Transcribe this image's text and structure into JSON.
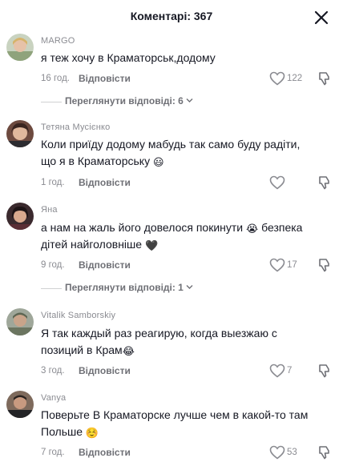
{
  "header": {
    "title": "Коментарі: 367"
  },
  "comments": [
    {
      "author": "MARGO",
      "text": "я теж хочу в Краматорськ,додому",
      "time": "16 год.",
      "reply_label": "Відповісти",
      "likes": "122",
      "view_replies": "Переглянути відповіді: 6"
    },
    {
      "author": "Тетяна Мусієнко",
      "text": "Коли приїду додому мабудь так само буду радіти, що я в Краматорську",
      "emoji": "😃",
      "time": "1 год.",
      "reply_label": "Відповісти",
      "likes": ""
    },
    {
      "author": "Яна",
      "text": "а нам на жаль його довелося покинути",
      "emoji": "😭",
      "text2": "безпека дітей найголовніше",
      "emoji2": "🖤",
      "time": "9 год.",
      "reply_label": "Відповісти",
      "likes": "17",
      "view_replies": "Переглянути відповіді: 1"
    },
    {
      "author": "Vitalik Samborskiy",
      "text": "Я так каждый раз реагирую, когда выезжаю с позиций в Крам",
      "emoji": "😂",
      "time": "3 год.",
      "reply_label": "Відповісти",
      "likes": "7"
    },
    {
      "author": "Vanya",
      "text": "Поверьте В Краматорске лучше чем в какой-то там Польше",
      "emoji": "☺️",
      "time": "7 год.",
      "reply_label": "Відповісти",
      "likes": "53"
    }
  ],
  "icons": {
    "close": "close-icon",
    "like": "heart-outline-icon",
    "dislike": "thumbs-down-icon",
    "chevron": "chevron-down-icon"
  },
  "colors": {
    "text": "#161823",
    "muted": "#8a8b91",
    "reply": "#6f7076"
  }
}
